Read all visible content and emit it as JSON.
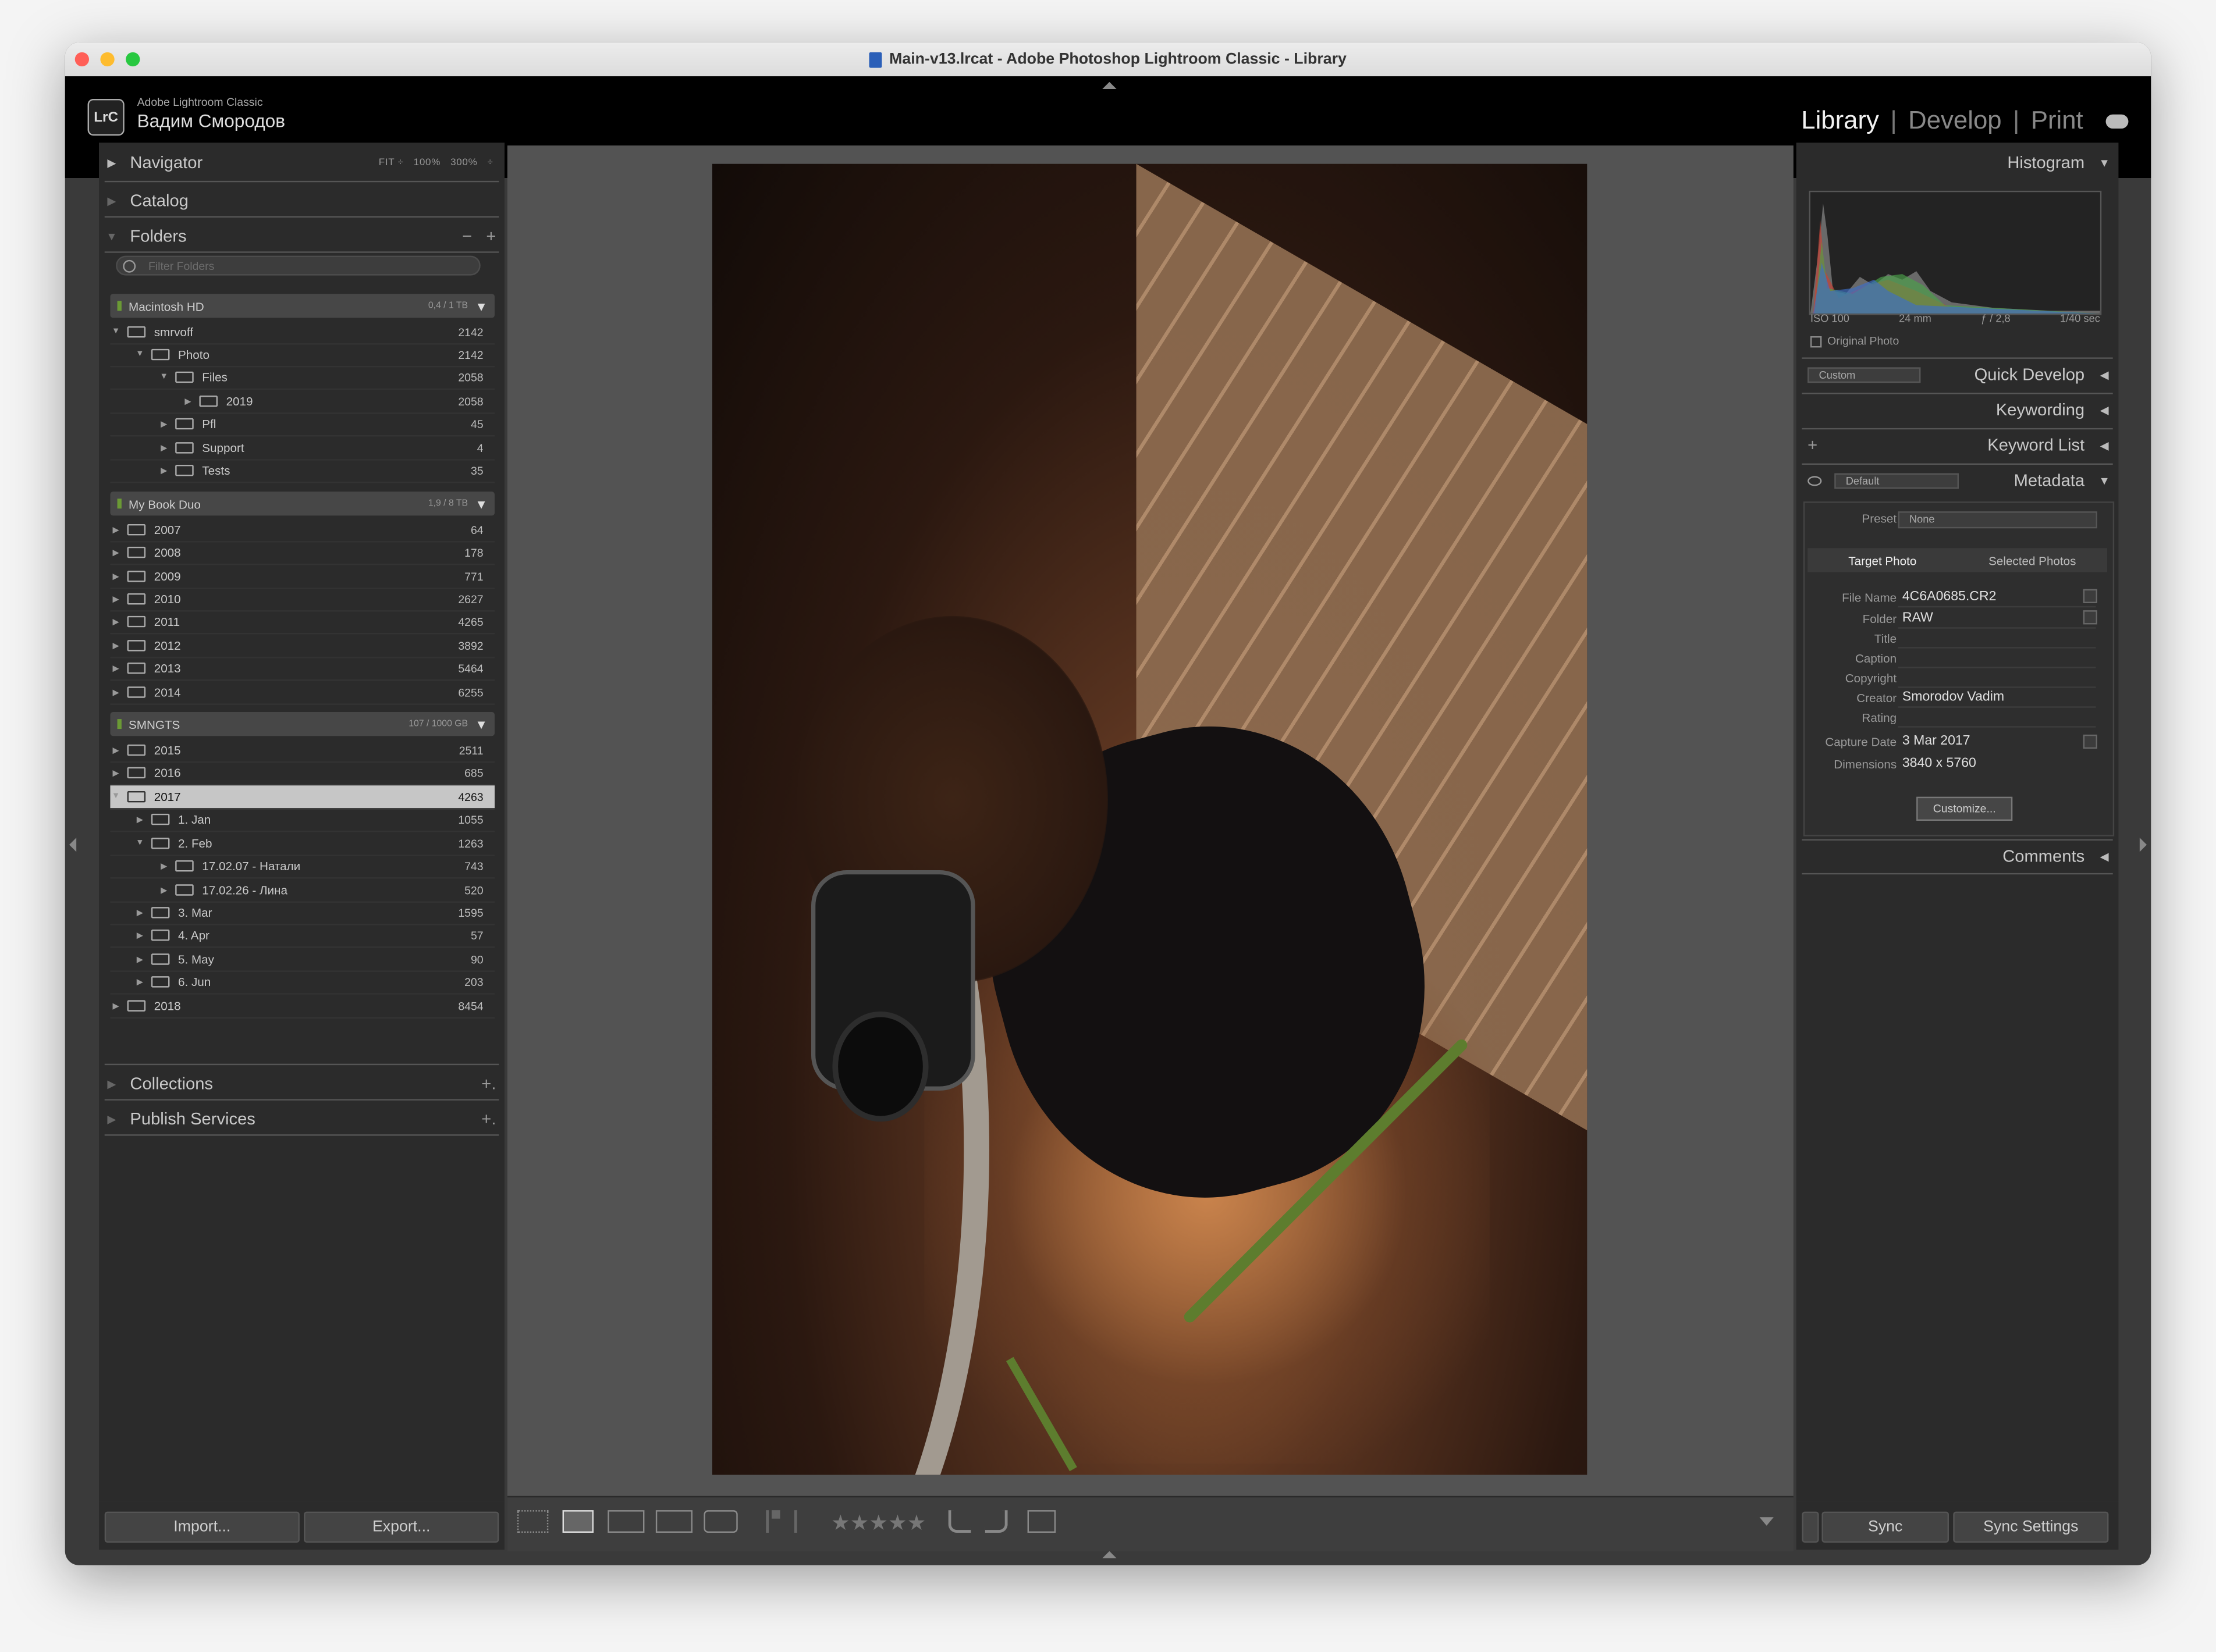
{
  "window": {
    "title": "Main-v13.lrcat - Adobe Photoshop Lightroom Classic - Library"
  },
  "identity": {
    "app": "Adobe Lightroom Classic",
    "user": "Вадим Смородов",
    "logo": "LrC"
  },
  "modules": {
    "library": "Library",
    "develop": "Develop",
    "print": "Print",
    "sep": "|"
  },
  "navigator": {
    "label": "Navigator",
    "fit": "FIT ÷",
    "z100": "100%",
    "z300": "300%",
    "arrow": "÷"
  },
  "catalog": {
    "label": "Catalog"
  },
  "folders": {
    "label": "Folders",
    "minus": "−",
    "plus": "+",
    "filter_placeholder": "Filter Folders"
  },
  "volumes": [
    {
      "name": "Macintosh HD",
      "cap": "0,4 / 1 TB"
    },
    {
      "name": "My Book Duo",
      "cap": "1,9 / 8 TB"
    },
    {
      "name": "SMNGTS",
      "cap": "107 / 1000 GB"
    }
  ],
  "folder_rows": [
    {
      "name": "smrvoff",
      "count": "2142"
    },
    {
      "name": "Photo",
      "count": "2142"
    },
    {
      "name": "Files",
      "count": "2058"
    },
    {
      "name": "2019",
      "count": "2058"
    },
    {
      "name": "Pfl",
      "count": "45"
    },
    {
      "name": "Support",
      "count": "4"
    },
    {
      "name": "Tests",
      "count": "35"
    },
    {
      "name": "2007",
      "count": "64"
    },
    {
      "name": "2008",
      "count": "178"
    },
    {
      "name": "2009",
      "count": "771"
    },
    {
      "name": "2010",
      "count": "2627"
    },
    {
      "name": "2011",
      "count": "4265"
    },
    {
      "name": "2012",
      "count": "3892"
    },
    {
      "name": "2013",
      "count": "5464"
    },
    {
      "name": "2014",
      "count": "6255"
    },
    {
      "name": "2015",
      "count": "2511"
    },
    {
      "name": "2016",
      "count": "685"
    },
    {
      "name": "2017",
      "count": "4263"
    },
    {
      "name": "1. Jan",
      "count": "1055"
    },
    {
      "name": "2. Feb",
      "count": "1263"
    },
    {
      "name": "17.02.07 - Натали",
      "count": "743"
    },
    {
      "name": "17.02.26 - Лина",
      "count": "520"
    },
    {
      "name": "3. Mar",
      "count": "1595"
    },
    {
      "name": "4. Apr",
      "count": "57"
    },
    {
      "name": "5. May",
      "count": "90"
    },
    {
      "name": "6. Jun",
      "count": "203"
    },
    {
      "name": "2018",
      "count": "8454"
    }
  ],
  "collections": {
    "label": "Collections",
    "plus": "+."
  },
  "publish": {
    "label": "Publish Services",
    "plus": "+."
  },
  "bottom_left": {
    "import": "Import...",
    "export": "Export..."
  },
  "toolbar": {
    "stars": "★★★★★"
  },
  "histogram": {
    "label": "Histogram",
    "iso": "ISO 100",
    "focal": "24 mm",
    "aperture": "ƒ / 2,8",
    "shutter": "1/40 sec",
    "original_photo": "Original Photo"
  },
  "quick_develop": {
    "label": "Quick Develop",
    "preset": "Custom"
  },
  "keywording": {
    "label": "Keywording"
  },
  "keyword_list": {
    "label": "Keyword List",
    "plus": "+"
  },
  "metadata": {
    "label": "Metadata",
    "preset_select": "Default",
    "preset_label": "Preset",
    "preset_value": "None",
    "tab_target": "Target Photo",
    "tab_selected": "Selected Photos",
    "fields": [
      {
        "label": "File Name",
        "value": "4C6A0685.CR2"
      },
      {
        "label": "Folder",
        "value": "RAW"
      },
      {
        "label": "Title",
        "value": ""
      },
      {
        "label": "Caption",
        "value": ""
      },
      {
        "label": "Copyright",
        "value": ""
      },
      {
        "label": "Creator",
        "value": "Smorodov Vadim"
      },
      {
        "label": "Rating",
        "value": ""
      },
      {
        "label": "Capture Date",
        "value": "3 Mar 2017"
      },
      {
        "label": "Dimensions",
        "value": "3840 x 5760"
      }
    ],
    "customize": "Customize..."
  },
  "comments": {
    "label": "Comments"
  },
  "bottom_right": {
    "sync": "Sync",
    "sync_settings": "Sync Settings"
  },
  "icons": [
    "search-icon",
    "folder-icon",
    "cloud-icon",
    "grid-view-icon",
    "loupe-view-icon",
    "compare-view-icon",
    "survey-view-icon",
    "people-view-icon",
    "flag-icon",
    "reject-flag-icon",
    "rotate-left-icon",
    "rotate-right-icon",
    "crop-icon"
  ]
}
